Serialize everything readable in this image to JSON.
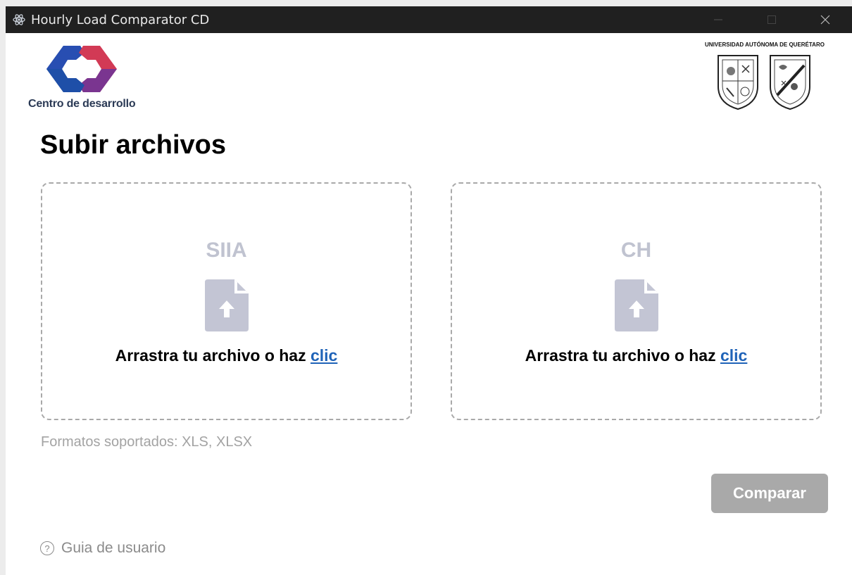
{
  "window": {
    "title": "Hourly Load Comparator CD",
    "icon": "electron-app-icon",
    "controls": [
      "minimize-icon",
      "maximize-icon",
      "close-icon"
    ]
  },
  "branding": {
    "left_logo_caption": "Centro de desarrollo",
    "left_logo_colors": {
      "blue": "#1f3a8c",
      "red": "#d23a55",
      "purple": "#7a3590"
    },
    "right_logo_caption": "UNIVERSIDAD AUTÓNOMA DE QUERÉTARO"
  },
  "page": {
    "title": "Subir archivos",
    "formats_note": "Formatos soportados: XLS, XLSX",
    "compare_button": "Comparar",
    "user_guide": "Guia de usuario",
    "help_icon_glyph": "?"
  },
  "dropzones": [
    {
      "label": "SIIA",
      "text": "Arrastra tu archivo o haz",
      "link": "clic",
      "icon": "file-upload-icon"
    },
    {
      "label": "CH",
      "text": "Arrastra tu archivo o haz",
      "link": "clic",
      "icon": "file-upload-icon"
    }
  ],
  "colors": {
    "titlebar": "#202020",
    "link": "#1f63b8",
    "disabled_button": "#a9a9a9",
    "muted_label": "#c0c3d0"
  }
}
